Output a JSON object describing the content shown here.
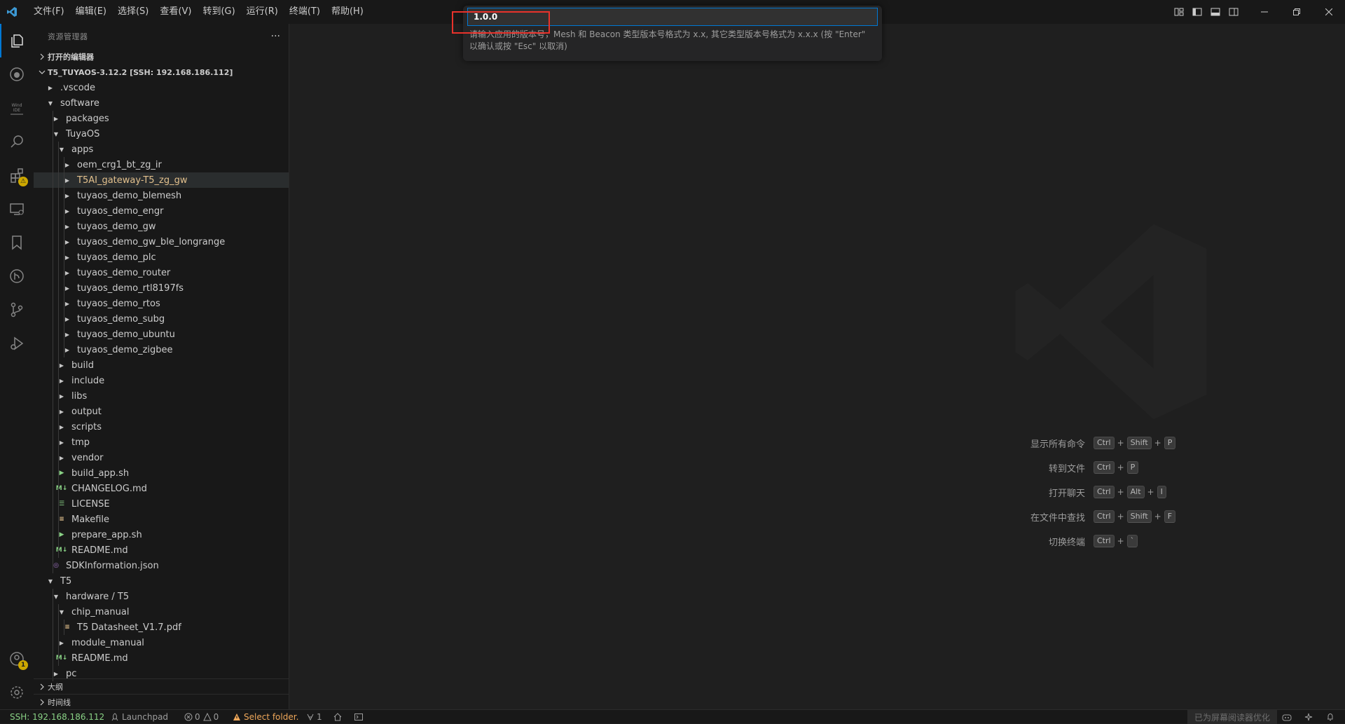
{
  "titlebar": {
    "menu": [
      "文件(F)",
      "编辑(E)",
      "选择(S)",
      "查看(V)",
      "转到(G)",
      "运行(R)",
      "终端(T)",
      "帮助(H)"
    ]
  },
  "sidebar": {
    "title": "资源管理器",
    "open_editors": "打开的编辑器",
    "workspace": "T5_TUYAOS-3.12.2 [SSH: 192.168.186.112]",
    "tree": [
      {
        "label": ".vscode",
        "depth": 1,
        "kind": "folder",
        "open": false
      },
      {
        "label": "software",
        "depth": 1,
        "kind": "folder",
        "open": true
      },
      {
        "label": "packages",
        "depth": 2,
        "kind": "folder",
        "open": false
      },
      {
        "label": "TuyaOS",
        "depth": 2,
        "kind": "folder",
        "open": true
      },
      {
        "label": "apps",
        "depth": 3,
        "kind": "folder",
        "open": true
      },
      {
        "label": "oem_crg1_bt_zg_ir",
        "depth": 4,
        "kind": "folder",
        "open": false
      },
      {
        "label": "T5AI_gateway-T5_zg_gw",
        "depth": 4,
        "kind": "folder",
        "open": false,
        "selected": true
      },
      {
        "label": "tuyaos_demo_blemesh",
        "depth": 4,
        "kind": "folder",
        "open": false
      },
      {
        "label": "tuyaos_demo_engr",
        "depth": 4,
        "kind": "folder",
        "open": false
      },
      {
        "label": "tuyaos_demo_gw",
        "depth": 4,
        "kind": "folder",
        "open": false
      },
      {
        "label": "tuyaos_demo_gw_ble_longrange",
        "depth": 4,
        "kind": "folder",
        "open": false
      },
      {
        "label": "tuyaos_demo_plc",
        "depth": 4,
        "kind": "folder",
        "open": false
      },
      {
        "label": "tuyaos_demo_router",
        "depth": 4,
        "kind": "folder",
        "open": false
      },
      {
        "label": "tuyaos_demo_rtl8197fs",
        "depth": 4,
        "kind": "folder",
        "open": false
      },
      {
        "label": "tuyaos_demo_rtos",
        "depth": 4,
        "kind": "folder",
        "open": false
      },
      {
        "label": "tuyaos_demo_subg",
        "depth": 4,
        "kind": "folder",
        "open": false
      },
      {
        "label": "tuyaos_demo_ubuntu",
        "depth": 4,
        "kind": "folder",
        "open": false
      },
      {
        "label": "tuyaos_demo_zigbee",
        "depth": 4,
        "kind": "folder",
        "open": false
      },
      {
        "label": "build",
        "depth": 3,
        "kind": "folder",
        "open": false
      },
      {
        "label": "include",
        "depth": 3,
        "kind": "folder",
        "open": false
      },
      {
        "label": "libs",
        "depth": 3,
        "kind": "folder",
        "open": false
      },
      {
        "label": "output",
        "depth": 3,
        "kind": "folder",
        "open": false
      },
      {
        "label": "scripts",
        "depth": 3,
        "kind": "folder",
        "open": false
      },
      {
        "label": "tmp",
        "depth": 3,
        "kind": "folder",
        "open": false
      },
      {
        "label": "vendor",
        "depth": 3,
        "kind": "folder",
        "open": false
      },
      {
        "label": "build_app.sh",
        "depth": 3,
        "kind": "shell"
      },
      {
        "label": "CHANGELOG.md",
        "depth": 3,
        "kind": "markdown"
      },
      {
        "label": "LICENSE",
        "depth": 3,
        "kind": "license"
      },
      {
        "label": "Makefile",
        "depth": 3,
        "kind": "makefile"
      },
      {
        "label": "prepare_app.sh",
        "depth": 3,
        "kind": "shell"
      },
      {
        "label": "README.md",
        "depth": 3,
        "kind": "markdown"
      },
      {
        "label": "SDKInformation.json",
        "depth": 2,
        "kind": "json"
      },
      {
        "label": "T5",
        "depth": 1,
        "kind": "folder",
        "open": true
      },
      {
        "label": "hardware / T5",
        "depth": 2,
        "kind": "folder",
        "open": true
      },
      {
        "label": "chip_manual",
        "depth": 3,
        "kind": "folder",
        "open": true
      },
      {
        "label": "T5 Datasheet_V1.7.pdf",
        "depth": 4,
        "kind": "pdf"
      },
      {
        "label": "module_manual",
        "depth": 3,
        "kind": "folder",
        "open": false
      },
      {
        "label": "README.md",
        "depth": 3,
        "kind": "markdown"
      },
      {
        "label": "pc",
        "depth": 2,
        "kind": "folder",
        "open": false
      }
    ],
    "outline": "大纲",
    "timeline": "时间线"
  },
  "quick_input": {
    "value": "1.0.0",
    "message_line1": "请输入应用的版本号，Mesh 和 Beacon 类型版本号格式为 x.x, 其它类型版本号格式为 x.x.x (按 \"Enter\"",
    "message_line2": "以确认或按 \"Esc\" 以取消)"
  },
  "shortcuts": [
    {
      "label": "显示所有命令",
      "keys": [
        "Ctrl",
        "Shift",
        "P"
      ]
    },
    {
      "label": "转到文件",
      "keys": [
        "Ctrl",
        "P"
      ]
    },
    {
      "label": "打开聊天",
      "keys": [
        "Ctrl",
        "Alt",
        "I"
      ]
    },
    {
      "label": "在文件中查找",
      "keys": [
        "Ctrl",
        "Shift",
        "F"
      ]
    },
    {
      "label": "切换终端",
      "keys": [
        "Ctrl",
        "`"
      ]
    }
  ],
  "statusbar": {
    "remote": "SSH: 192.168.186.112",
    "launchpad": "Launchpad",
    "errors": "0",
    "warnings": "0",
    "select_folder": "Select folder.",
    "ports": "1",
    "screen_reader": "已为屏幕阅读器优化"
  },
  "activitybar": {
    "accounts_badge": "1",
    "extensions_badge": "⚠"
  },
  "colors": {
    "accent": "#0078d4",
    "selected_file": "#e2c08d",
    "highlight_box": "#e8322b",
    "warning": "#cca700"
  }
}
